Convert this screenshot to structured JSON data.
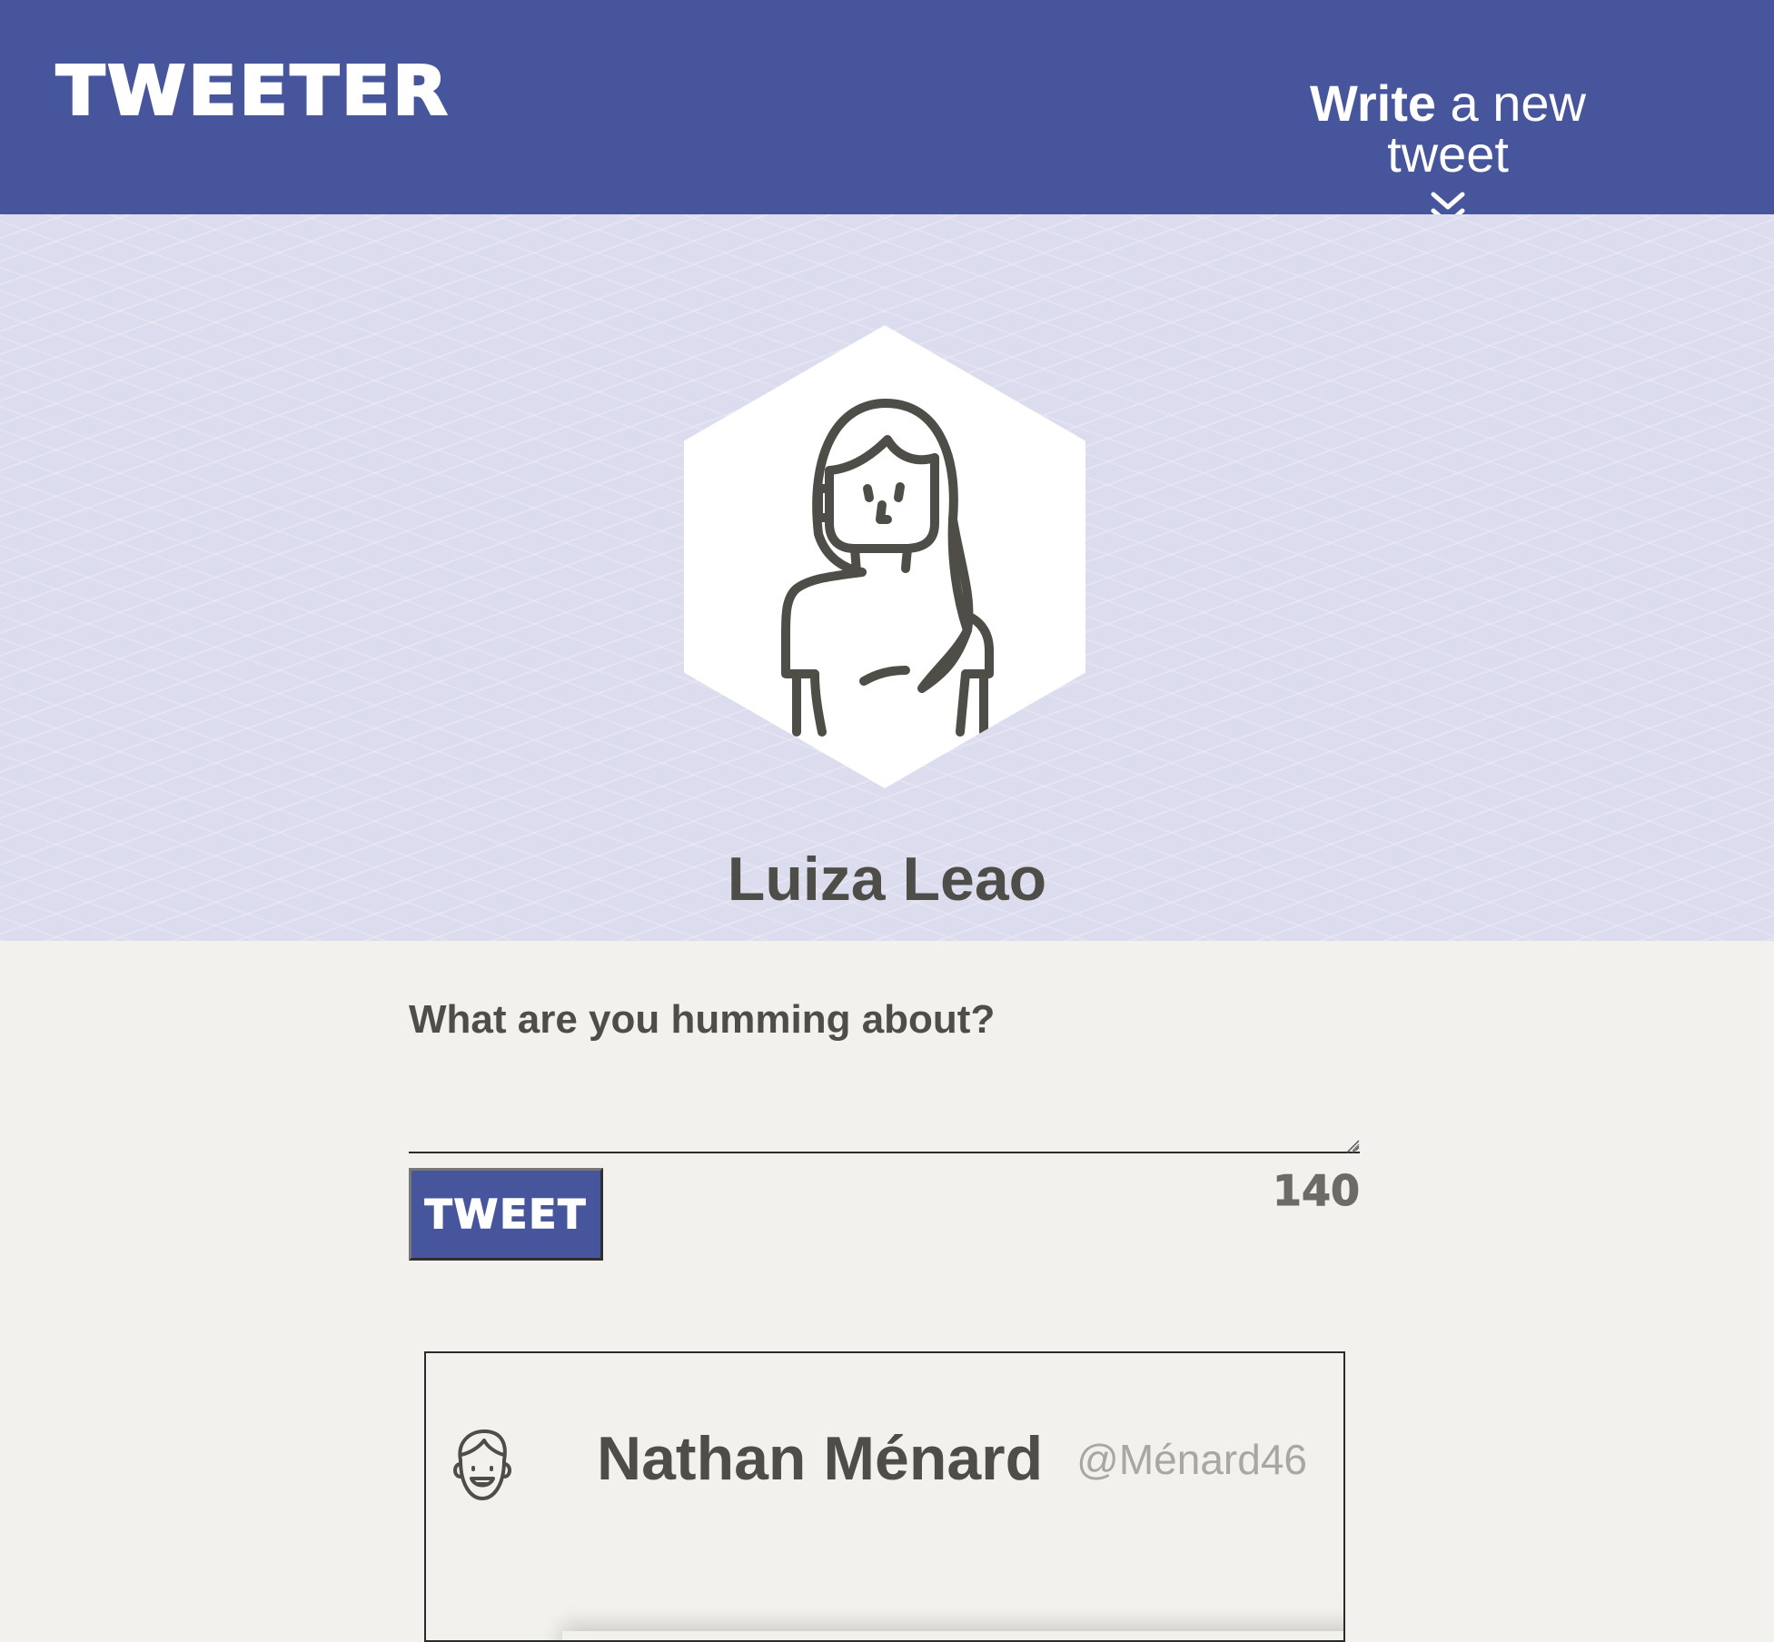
{
  "header": {
    "logo": "TWEETER",
    "write_strong": "Write",
    "write_rest": " a new tweet",
    "chevron_icon": "double-chevron-down-icon"
  },
  "profile": {
    "name": "Luiza Leao",
    "avatar_icon": "woman-avatar-icon"
  },
  "compose": {
    "label": "What are you humming about?",
    "text_value": "",
    "button_label": "TWEET",
    "char_count": "140"
  },
  "tweets": [
    {
      "author": "Nathan Ménard",
      "handle": "@Ménard46",
      "avatar_icon": "man-avatar-icon"
    }
  ],
  "colors": {
    "primary": "#47569c",
    "banner": "#dcdcef",
    "page_bg": "#f2f1ed",
    "text": "#4f4d48",
    "handle": "#a9a7a2"
  }
}
